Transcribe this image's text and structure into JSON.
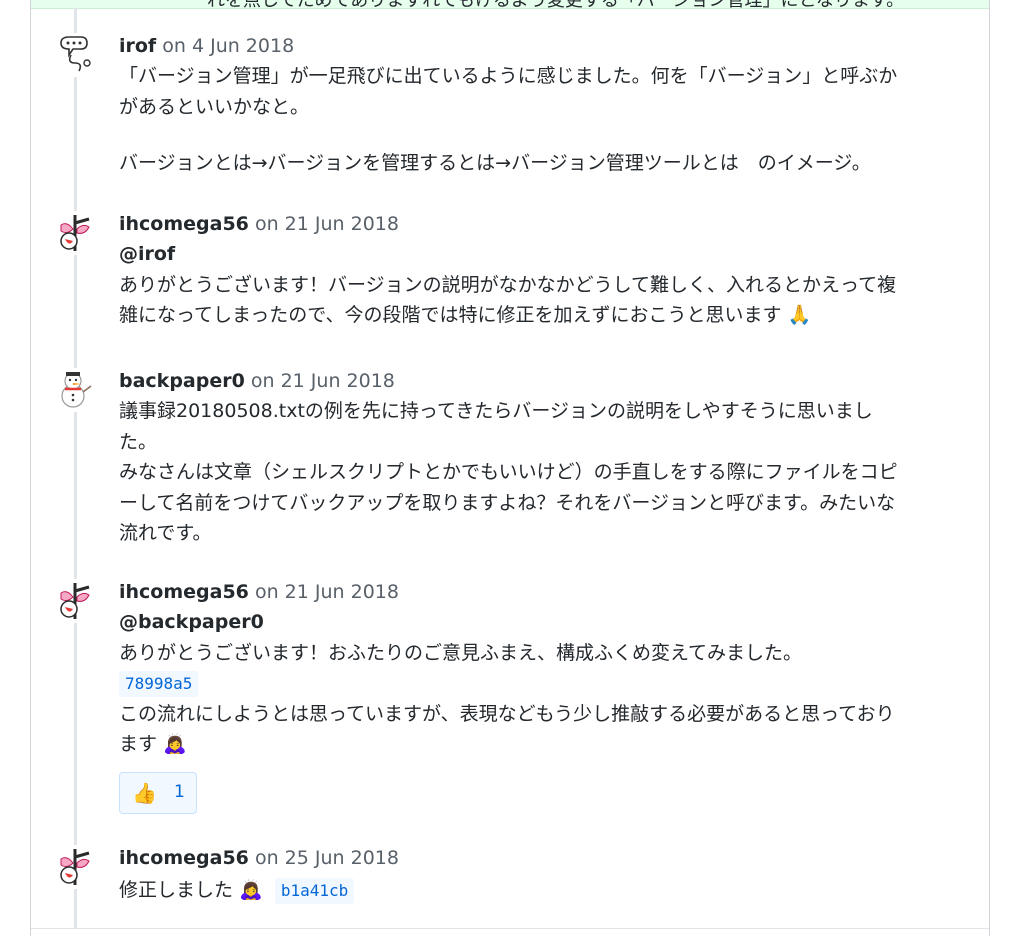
{
  "top_strip_text": "れを点してためでありますれてもけるよう変更する「バージョン管理」にとなります。",
  "comments": [
    {
      "author": "irof",
      "date": "on 4 Jun 2018",
      "lines": [
        "「バージョン管理」が一足飛びに出ているように感じました。何を「バージョン」と呼ぶか",
        "があるといいかなと。",
        "",
        "バージョンとは→バージョンを管理するとは→バージョン管理ツールとは　のイメージ。"
      ]
    },
    {
      "author": "ihcomega56",
      "date": "on 21 Jun 2018",
      "mention": "@irof",
      "lines": [
        "ありがとうございます！バージョンの説明がなかなかどうして難しく、入れるとかえって複",
        "雑になってしまったので、今の段階では特に修正を加えずにおこうと思います"
      ],
      "emoji": "🙏"
    },
    {
      "author": "backpaper0",
      "date": "on 21 Jun 2018",
      "lines": [
        "議事録20180508.txtの例を先に持ってきたらバージョンの説明をしやすそうに思いまし",
        "た。",
        "みなさんは文章（シェルスクリプトとかでもいいけど）の手直しをする際にファイルをコピ",
        "ーして名前をつけてバックアップを取りますよね？それをバージョンと呼びます。みたいな",
        "流れです。"
      ]
    },
    {
      "author": "ihcomega56",
      "date": "on 21 Jun 2018",
      "mention": "@backpaper0",
      "line1": "ありがとうございます！おふたりのご意見ふまえ、構成ふくめ変えてみました。",
      "sha": "78998a5",
      "line2": "この流れにしようとは思っていますが、表現などもう少し推敲する必要があると思っており",
      "line3": "ます",
      "emoji": "🙇‍♀️",
      "reaction": {
        "emoji": "👍",
        "count": "1"
      }
    },
    {
      "author": "ihcomega56",
      "date": "on 25 Jun 2018",
      "text": "修正しました",
      "emoji": "🙇‍♀️",
      "sha": "b1a41cb"
    }
  ],
  "icons": {
    "irof_avatar": "speech-bubble-doodle",
    "ihcomega56_avatar": "pink-ribbon-figure",
    "backpaper0_avatar": "snowman"
  }
}
